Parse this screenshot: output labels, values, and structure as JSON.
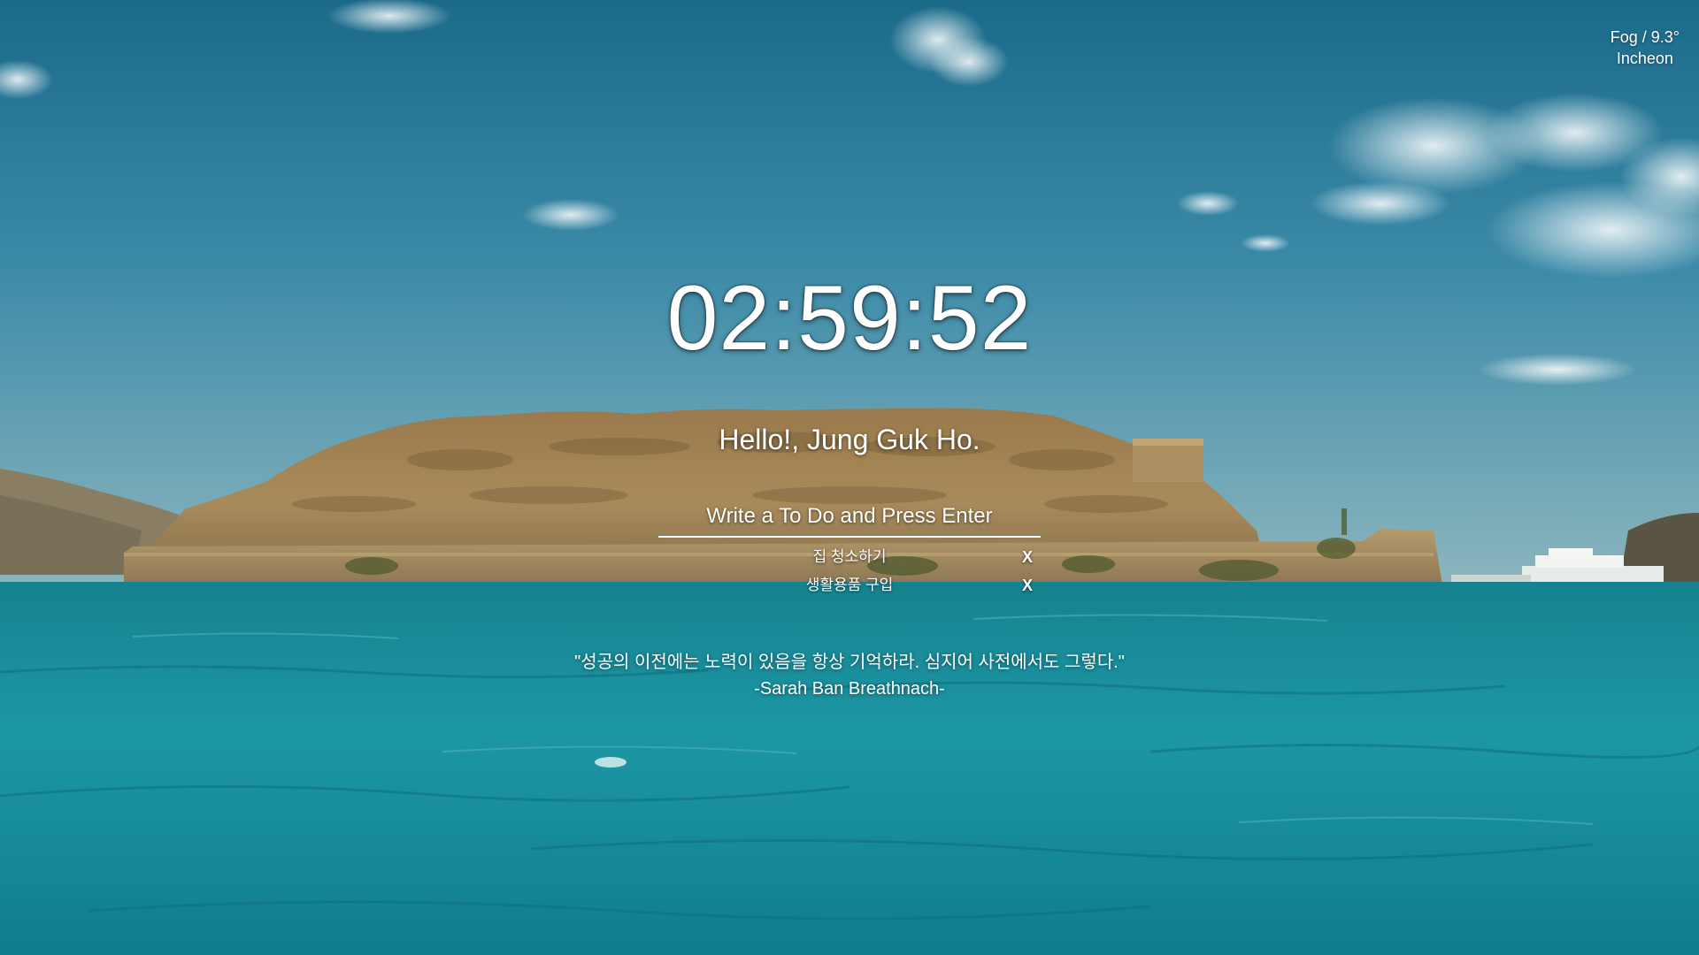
{
  "weather": {
    "line1": "Fog / 9.3°",
    "city": "Incheon"
  },
  "clock": {
    "time": "02:59:52"
  },
  "greeting": {
    "text": "Hello!, Jung Guk Ho."
  },
  "todo": {
    "placeholder": "Write a To Do and Press Enter",
    "delete_label": "X",
    "items": [
      {
        "text": "집 청소하기"
      },
      {
        "text": "생활용품 구입"
      }
    ]
  },
  "quote": {
    "text": "\"성공의 이전에는 노력이 있음을 항상 기억하라. 심지어 사전에서도 그렇다.\"",
    "author": "-Sarah Ban Breathnach-"
  },
  "colors": {
    "sky_top": "#1d6f8e",
    "sky_bottom": "#78aab8",
    "sea": "#1b8fa0",
    "island": "#a88757"
  }
}
